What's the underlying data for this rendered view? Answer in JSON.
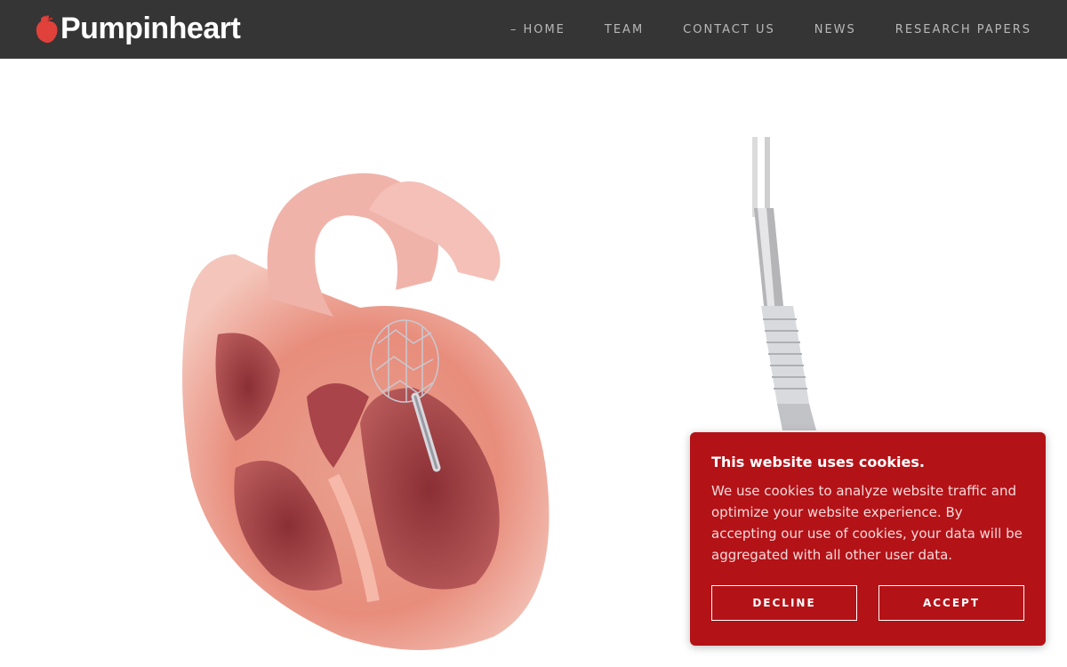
{
  "brand": {
    "name": "Pumpinheart",
    "icon": "heart-icon",
    "icon_color": "#e0413a"
  },
  "nav": {
    "items": [
      {
        "label": "HOME",
        "active": true
      },
      {
        "label": "TEAM"
      },
      {
        "label": "CONTACT US"
      },
      {
        "label": "NEWS"
      },
      {
        "label": "RESEARCH PAPERS"
      }
    ]
  },
  "hero": {
    "images": [
      "heart-anatomy-illustration",
      "heart-pump-device-image"
    ]
  },
  "cookie_banner": {
    "title": "This website uses cookies.",
    "body": "We use cookies to analyze website traffic and optimize your website experience. By accepting our use of cookies, your data will be aggregated with all other user data.",
    "decline_label": "DECLINE",
    "accept_label": "ACCEPT",
    "background": "#b31217"
  },
  "colors": {
    "header_bg": "#353535",
    "nav_text": "#b8b8b8"
  }
}
